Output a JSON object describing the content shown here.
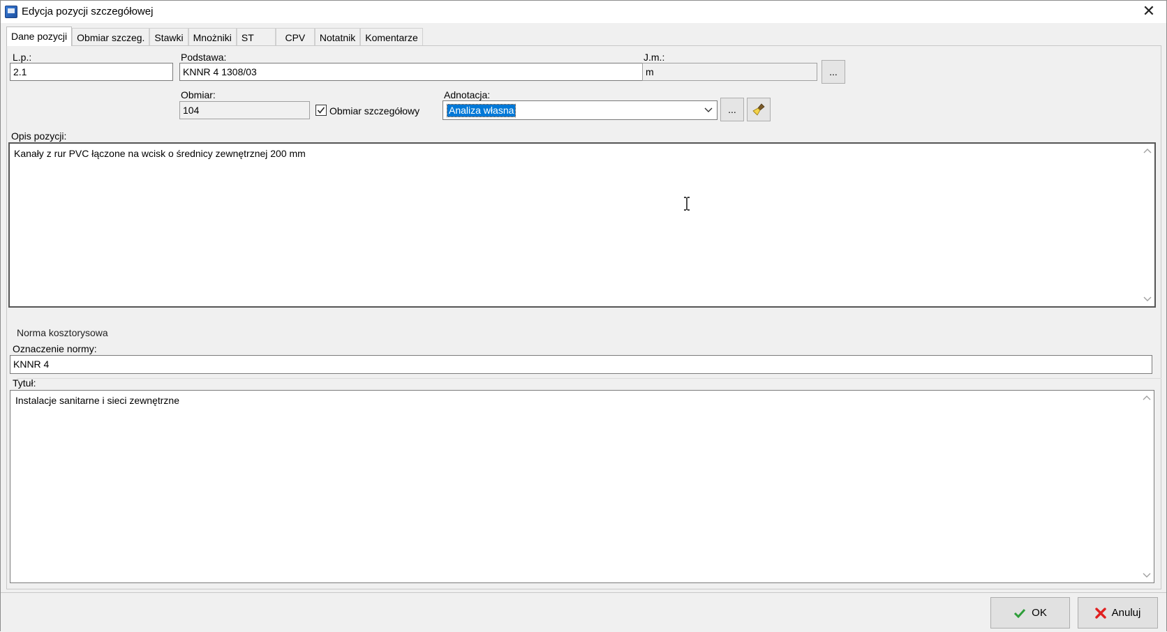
{
  "window": {
    "title": "Edycja pozycji szczegółowej"
  },
  "tabs": [
    {
      "label": "Dane pozycji"
    },
    {
      "label": "Obmiar szczeg."
    },
    {
      "label": "Stawki"
    },
    {
      "label": "Mnożniki"
    },
    {
      "label": "ST"
    },
    {
      "label": "CPV"
    },
    {
      "label": "Notatnik"
    },
    {
      "label": "Komentarze"
    }
  ],
  "form": {
    "lp_label": "L.p.:",
    "lp_value": "2.1",
    "podstawa_label": "Podstawa:",
    "podstawa_value": "KNNR 4 1308/03",
    "jm_label": "J.m.:",
    "jm_value": "m",
    "jm_button": "...",
    "obmiar_label": "Obmiar:",
    "obmiar_value": "104",
    "obmiar_szczeg_label": "Obmiar szczegółowy",
    "obmiar_szczeg_checked": true,
    "adnotacja_label": "Adnotacja:",
    "adnotacja_value": "Analiza własna",
    "adnotacja_button": "...",
    "opis_label": "Opis pozycji:",
    "opis_value": "Kanały z rur PVC łączone na wcisk o średnicy zewnętrznej 200 mm"
  },
  "norma": {
    "group_label": "Norma kosztorysowa",
    "oznaczenie_label": "Oznaczenie normy:",
    "oznaczenie_value": "KNNR 4",
    "tytul_label": "Tytuł:",
    "tytul_value": "Instalacje sanitarne i sieci zewnętrzne"
  },
  "footer": {
    "ok_label": "OK",
    "cancel_label": "Anuluj"
  },
  "colors": {
    "selection": "#0078d7",
    "ok_check": "#2e9e3a",
    "cancel_x": "#e02020"
  }
}
